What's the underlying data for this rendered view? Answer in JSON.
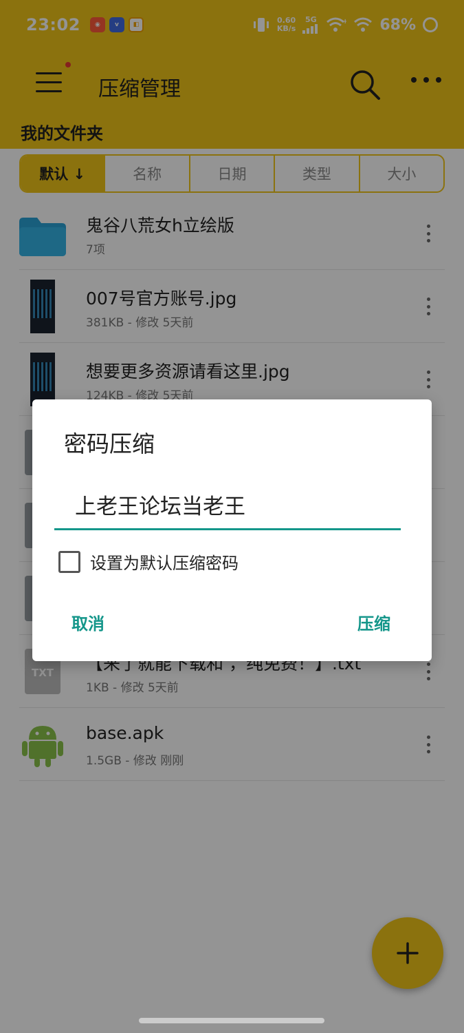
{
  "status_bar": {
    "time": "23:02",
    "app_icons": [
      "douyin-icon",
      "vivo-icon",
      "shop-icon"
    ],
    "net_speed_value": "0.60",
    "net_speed_unit": "KB/s",
    "signal_label": "5G",
    "battery": "68%"
  },
  "app_bar": {
    "title": "压缩管理"
  },
  "breadcrumb": "我的文件夹",
  "sort_tabs": [
    {
      "label": "默认 ↓",
      "active": true
    },
    {
      "label": "名称",
      "active": false
    },
    {
      "label": "日期",
      "active": false
    },
    {
      "label": "类型",
      "active": false
    },
    {
      "label": "大小",
      "active": false
    }
  ],
  "files": [
    {
      "name": "鬼谷八荒女h立绘版",
      "meta": "7项",
      "icon": "folder-icon"
    },
    {
      "name": "007号官方账号.jpg",
      "meta": "381KB - 修改 5天前",
      "icon": "image-thumbnail"
    },
    {
      "name": "想要更多资源请看这里.jpg",
      "meta": "124KB - 修改 5天前",
      "icon": "image-thumbnail"
    },
    {
      "name": "",
      "meta": "",
      "icon": "file-icon"
    },
    {
      "name": "",
      "meta": "",
      "icon": "file-icon"
    },
    {
      "name": "",
      "meta": "",
      "icon": "file-icon"
    },
    {
      "name": "【来了就能下载和 ，纯免费！】.txt",
      "meta": "1KB - 修改 5天前",
      "icon": "txt-file-icon"
    },
    {
      "name": "base.apk",
      "meta": "1.5GB - 修改 刚刚",
      "icon": "android-icon"
    }
  ],
  "dialog": {
    "title": "密码压缩",
    "password_value": "上老王论坛当老王",
    "checkbox_label": "设置为默认压缩密码",
    "cancel_label": "取消",
    "confirm_label": "压缩"
  },
  "colors": {
    "accent": "#f0c419",
    "dialog_teal": "#14968a"
  }
}
